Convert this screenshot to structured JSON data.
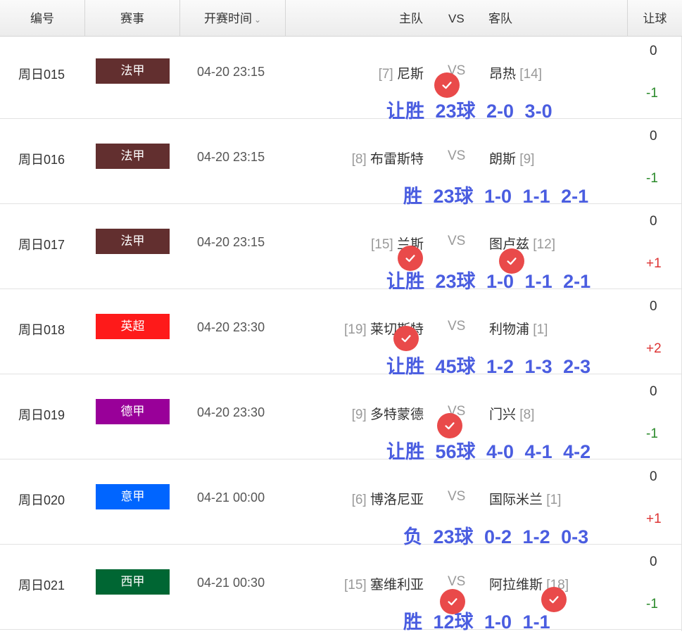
{
  "header": {
    "num": "编号",
    "event": "赛事",
    "time": "开赛时间",
    "home": "主队",
    "vs": "VS",
    "away": "客队",
    "handicap": "让球"
  },
  "rows": [
    {
      "id": "周日015",
      "league": "法甲",
      "league_color": "#622f2f",
      "time": "04-20 23:15",
      "home_rank": "[7]",
      "home": "尼斯",
      "vs": "VS",
      "away": "昂热",
      "away_rank": "[14]",
      "hcp_top": "0",
      "hcp_bottom": "-1",
      "annotation": "让胜 23球 2-0 3-0"
    },
    {
      "id": "周日016",
      "league": "法甲",
      "league_color": "#622f2f",
      "time": "04-20 23:15",
      "home_rank": "[8]",
      "home": "布雷斯特",
      "vs": "VS",
      "away": "朗斯",
      "away_rank": "[9]",
      "hcp_top": "0",
      "hcp_bottom": "-1",
      "annotation": "胜 23球 1-0 1-1 2-1"
    },
    {
      "id": "周日017",
      "league": "法甲",
      "league_color": "#622f2f",
      "time": "04-20 23:15",
      "home_rank": "[15]",
      "home": "兰斯",
      "vs": "VS",
      "away": "图卢兹",
      "away_rank": "[12]",
      "hcp_top": "0",
      "hcp_bottom": "+1",
      "annotation": "让胜 23球 1-0 1-1 2-1"
    },
    {
      "id": "周日018",
      "league": "英超",
      "league_color": "#fe1a1a",
      "time": "04-20 23:30",
      "home_rank": "[19]",
      "home": "莱切斯特",
      "vs": "VS",
      "away": "利物浦",
      "away_rank": "[1]",
      "hcp_top": "0",
      "hcp_bottom": "+2",
      "annotation": "让胜 45球 1-2 1-3 2-3"
    },
    {
      "id": "周日019",
      "league": "德甲",
      "league_color": "#990099",
      "time": "04-20 23:30",
      "home_rank": "[9]",
      "home": "多特蒙德",
      "vs": "VS",
      "away": "门兴",
      "away_rank": "[8]",
      "hcp_top": "0",
      "hcp_bottom": "-1",
      "annotation": "让胜 56球 4-0 4-1 4-2"
    },
    {
      "id": "周日020",
      "league": "意甲",
      "league_color": "#0065ff",
      "time": "04-21 00:00",
      "home_rank": "[6]",
      "home": "博洛尼亚",
      "vs": "VS",
      "away": "国际米兰",
      "away_rank": "[1]",
      "hcp_top": "0",
      "hcp_bottom": "+1",
      "annotation": "负 23球 0-2 1-2 0-3"
    },
    {
      "id": "周日021",
      "league": "西甲",
      "league_color": "#006633",
      "time": "04-21 00:30",
      "home_rank": "[15]",
      "home": "塞维利亚",
      "vs": "VS",
      "away": "阿拉维斯",
      "away_rank": "[18]",
      "hcp_top": "0",
      "hcp_bottom": "-1",
      "annotation": "胜 12球 1-0 1-1"
    }
  ],
  "icons": {
    "check": "check-mark-icon"
  },
  "colors": {
    "annotation": "#4a5de0",
    "check": "#e94a4a",
    "positive": "#d33333",
    "negative": "#2a8a2a"
  }
}
